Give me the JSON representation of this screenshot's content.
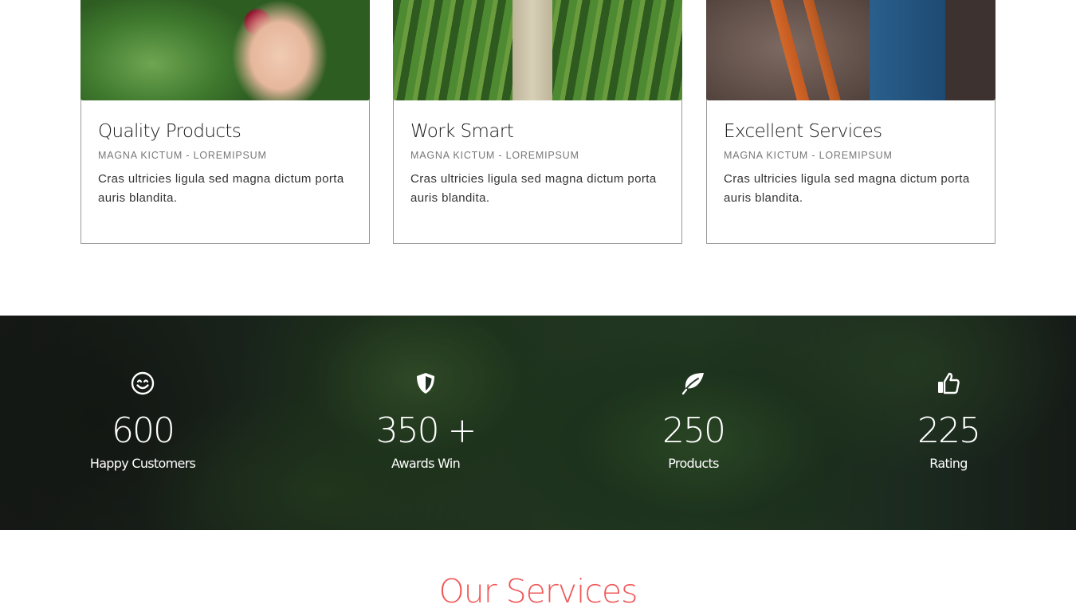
{
  "cards": [
    {
      "title": "Quality Products",
      "meta": "MAGNA KICTUM - LOREMIPSUM",
      "description": "Cras ultricies ligula sed magna dictum porta auris blandita."
    },
    {
      "title": "Work Smart",
      "meta": "MAGNA KICTUM - LOREMIPSUM",
      "description": "Cras ultricies ligula sed magna dictum porta auris blandita."
    },
    {
      "title": "Excellent Services",
      "meta": "MAGNA KICTUM - LOREMIPSUM",
      "description": "Cras ultricies ligula sed magna dictum porta auris blandita."
    }
  ],
  "stats": [
    {
      "icon": "smile-icon",
      "value": "600",
      "label": "Happy Customers"
    },
    {
      "icon": "shield-icon",
      "value": "350 +",
      "label": "Awards Win"
    },
    {
      "icon": "leaf-icon",
      "value": "250",
      "label": "Products"
    },
    {
      "icon": "thumbs-up-icon",
      "value": "225",
      "label": "Rating"
    }
  ],
  "services": {
    "title": "Our Services"
  },
  "colors": {
    "accent": "#f05a5a",
    "stat_text": "#ffffff",
    "card_border": "#9a9a9a"
  }
}
